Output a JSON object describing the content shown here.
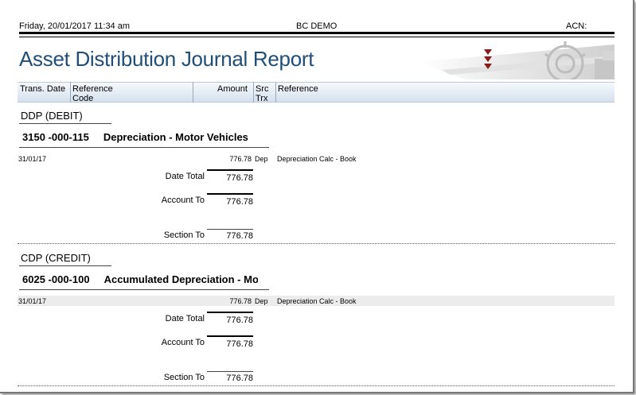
{
  "header": {
    "datetime": "Friday, 20/01/2017 11:34 am",
    "company": "BC DEMO",
    "acn": "ACN:"
  },
  "title": "Asset Distribution Journal Report",
  "columns": {
    "trans_date": "Trans. Date",
    "reference_code_1": "Reference",
    "reference_code_2": "Code",
    "amount": "Amount",
    "src_trx_1": "Src",
    "src_trx_2": "Trx",
    "reference": "Reference"
  },
  "sections": [
    {
      "label": "DDP (DEBIT)",
      "account_code": "3150 -000-115",
      "account_name": "Depreciation  - Motor Vehicles",
      "row": {
        "date": "31/01/17",
        "amount": "776.78",
        "src": "Dep",
        "reference": "Depreciation Calc - Book"
      },
      "date_total_label": "Date Total",
      "date_total": "776.78",
      "account_to_label": "Account To",
      "account_to": "776.78",
      "section_to_label": "Section To",
      "section_to": "776.78"
    },
    {
      "label": "CDP (CREDIT)",
      "account_code": "6025 -000-100",
      "account_name": "Accumulated Depreciation   - Mo",
      "row": {
        "date": "31/01/17",
        "amount": "776.78",
        "src": "Dep",
        "reference": "Depreciation Calc - Book"
      },
      "date_total_label": "Date Total",
      "date_total": "776.78",
      "account_to_label": "Account To",
      "account_to": "776.78",
      "section_to_label": "Section To",
      "section_to": "776.78"
    }
  ],
  "colors": {
    "title": "#1f4e79",
    "column_bar": "#d4e1ee",
    "arrows": "#8b1a1a"
  }
}
